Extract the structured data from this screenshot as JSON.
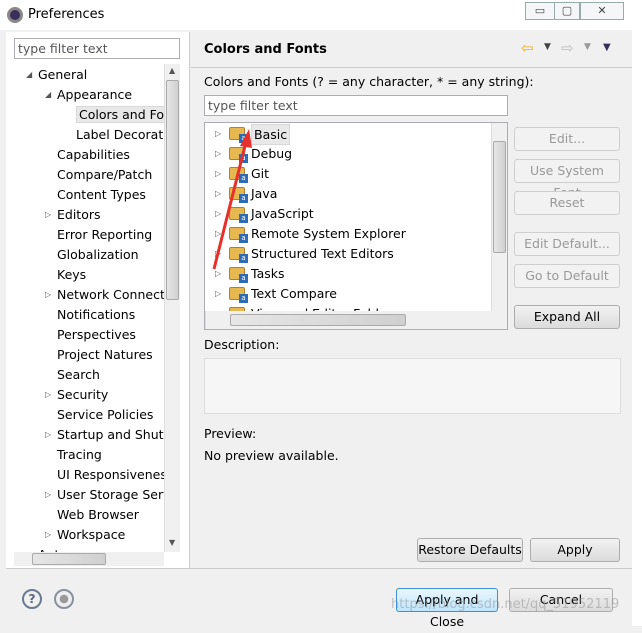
{
  "window": {
    "title": "Preferences",
    "minimize": "▭",
    "maximize": "▢",
    "close": "✕"
  },
  "left": {
    "filter_placeholder": "type filter text",
    "tree": [
      {
        "label": "General",
        "level": 0,
        "state": "expanded"
      },
      {
        "label": "Appearance",
        "level": 1,
        "state": "expanded"
      },
      {
        "label": "Colors and Fonts",
        "level": 2,
        "state": "leaf",
        "selected": true
      },
      {
        "label": "Label Decorations",
        "level": 2,
        "state": "leaf"
      },
      {
        "label": "Capabilities",
        "level": 1,
        "state": "leaf"
      },
      {
        "label": "Compare/Patch",
        "level": 1,
        "state": "leaf"
      },
      {
        "label": "Content Types",
        "level": 1,
        "state": "leaf"
      },
      {
        "label": "Editors",
        "level": 1,
        "state": "collapsed"
      },
      {
        "label": "Error Reporting",
        "level": 1,
        "state": "leaf"
      },
      {
        "label": "Globalization",
        "level": 1,
        "state": "leaf"
      },
      {
        "label": "Keys",
        "level": 1,
        "state": "leaf"
      },
      {
        "label": "Network Connections",
        "level": 1,
        "state": "collapsed"
      },
      {
        "label": "Notifications",
        "level": 1,
        "state": "leaf"
      },
      {
        "label": "Perspectives",
        "level": 1,
        "state": "leaf"
      },
      {
        "label": "Project Natures",
        "level": 1,
        "state": "leaf"
      },
      {
        "label": "Search",
        "level": 1,
        "state": "leaf"
      },
      {
        "label": "Security",
        "level": 1,
        "state": "collapsed"
      },
      {
        "label": "Service Policies",
        "level": 1,
        "state": "leaf"
      },
      {
        "label": "Startup and Shutdown",
        "level": 1,
        "state": "collapsed"
      },
      {
        "label": "Tracing",
        "level": 1,
        "state": "leaf"
      },
      {
        "label": "UI Responsiveness",
        "level": 1,
        "state": "leaf"
      },
      {
        "label": "User Storage Service",
        "level": 1,
        "state": "collapsed"
      },
      {
        "label": "Web Browser",
        "level": 1,
        "state": "leaf"
      },
      {
        "label": "Workspace",
        "level": 1,
        "state": "collapsed"
      },
      {
        "label": "Ant",
        "level": 0,
        "state": "collapsed"
      }
    ]
  },
  "page": {
    "title": "Colors and Fonts",
    "filter_label": "Colors and Fonts (? = any character, * = any string):",
    "filter_placeholder": "type filter text",
    "categories": [
      "Basic",
      "Debug",
      "Git",
      "Java",
      "JavaScript",
      "Remote System Explorer",
      "Structured Text Editors",
      "Tasks",
      "Text Compare",
      "View and Editor Folders"
    ],
    "buttons": {
      "edit": "Edit...",
      "use_system_font": "Use System Font",
      "reset": "Reset",
      "edit_default": "Edit Default...",
      "go_to_default": "Go to Default",
      "expand_all": "Expand All"
    },
    "description_label": "Description:",
    "preview_label": "Preview:",
    "preview_text": "No preview available.",
    "restore_defaults": "Restore Defaults",
    "apply": "Apply"
  },
  "bottom": {
    "apply_and_close": "Apply and Close",
    "cancel": "Cancel",
    "watermark": "https://blog.csdn.net/qq_51952119"
  },
  "colors": {
    "accent_arrow": "#e8302a",
    "nav_back": "#e8b020"
  }
}
